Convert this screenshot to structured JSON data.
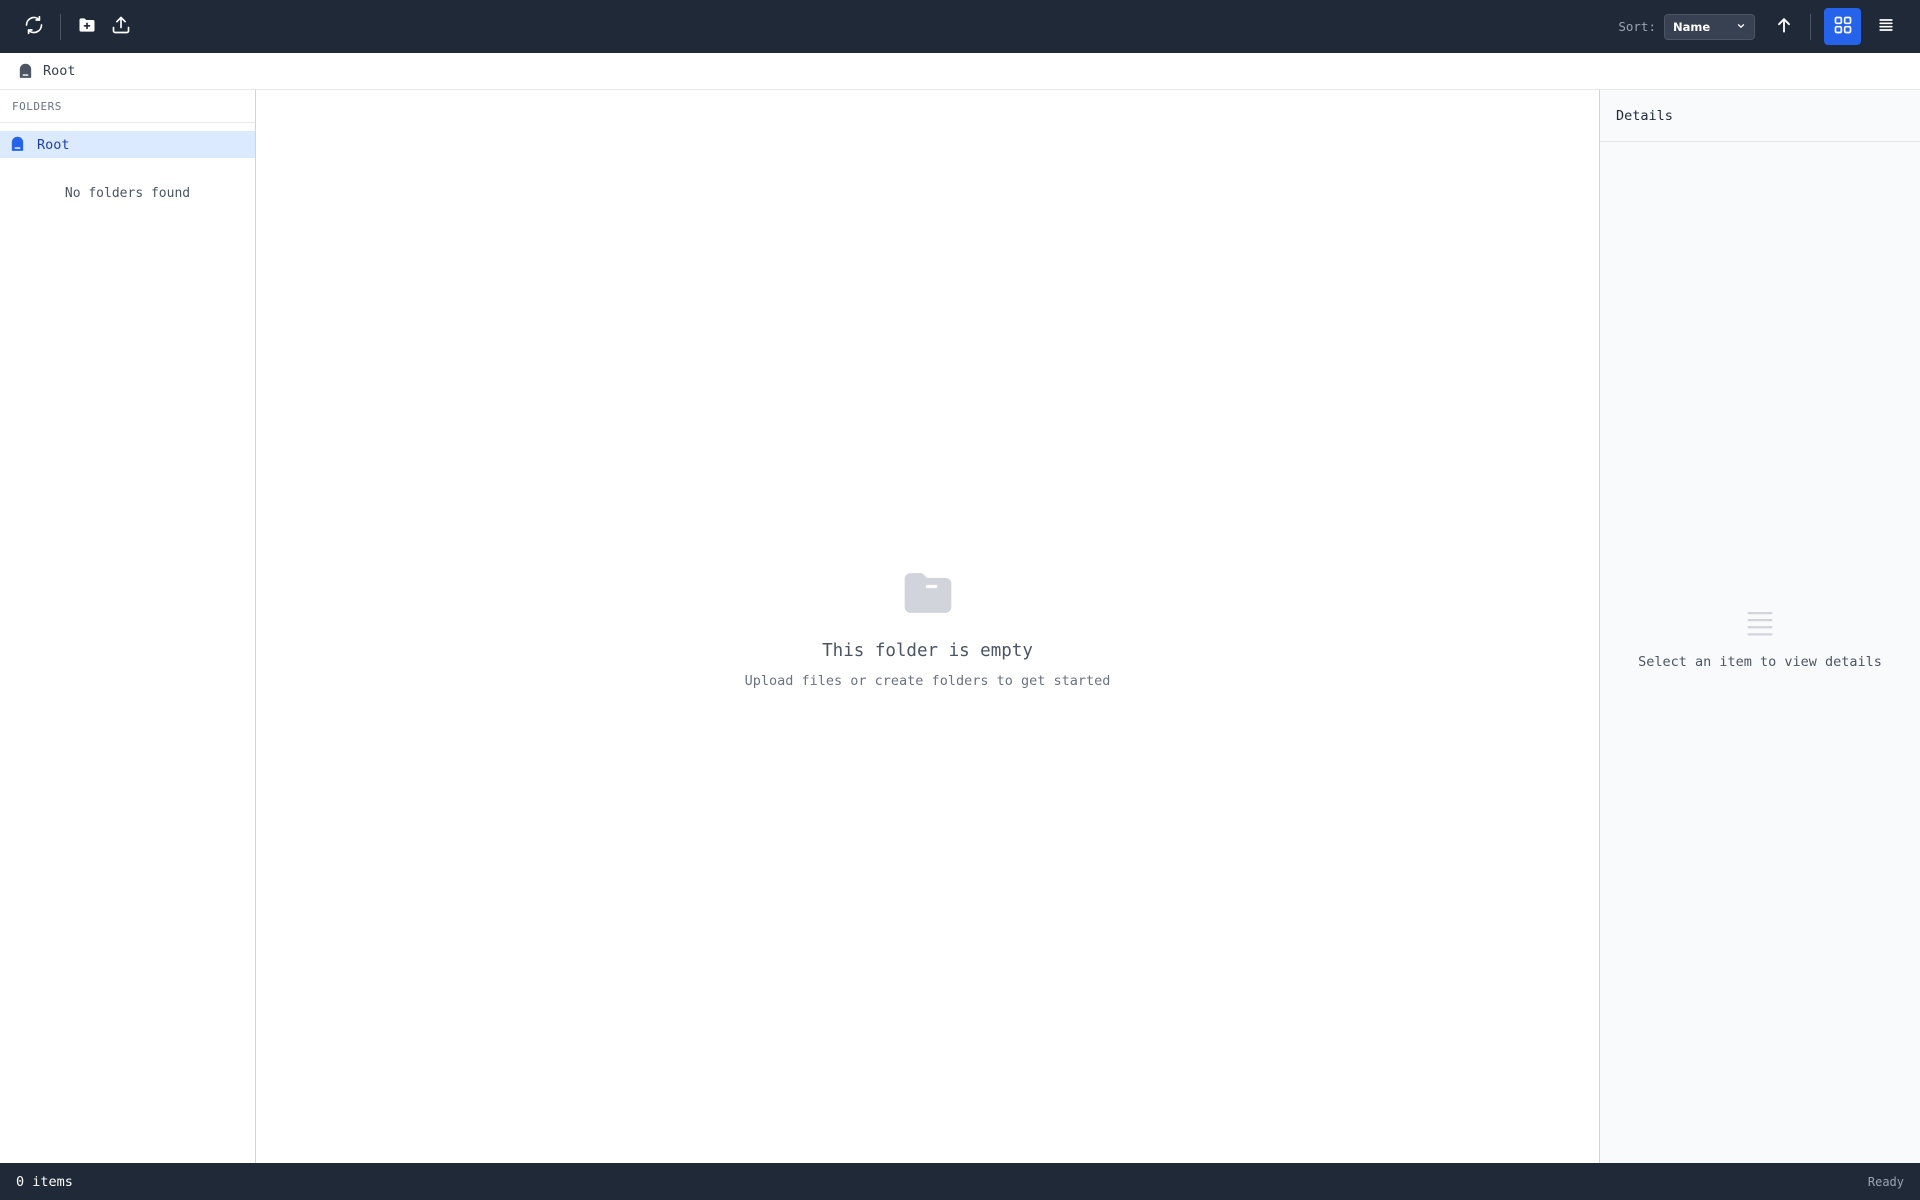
{
  "toolbar": {
    "refresh_icon": "refresh-icon",
    "new_folder_icon": "new-folder-icon",
    "upload_icon": "upload-icon",
    "sort_label": "Sort:",
    "sort_value": "Name",
    "sort_direction_icon": "arrow-up-icon",
    "grid_view_icon": "grid-view-icon",
    "list_view_icon": "list-view-icon",
    "active_view": "grid"
  },
  "breadcrumb": {
    "items": [
      {
        "label": "Root",
        "icon": "root-drive-icon"
      }
    ]
  },
  "sidebar": {
    "header": "FOLDERS",
    "tree": [
      {
        "label": "Root",
        "icon": "root-drive-icon",
        "selected": true
      }
    ],
    "empty_text": "No folders found"
  },
  "content": {
    "empty_icon": "empty-folder-icon",
    "empty_title": "This folder is empty",
    "empty_subtitle": "Upload files or create folders to get started"
  },
  "details": {
    "title": "Details",
    "placeholder_icon": "lines-icon",
    "placeholder_text": "Select an item to view details"
  },
  "statusbar": {
    "item_count": "0 items",
    "status": "Ready"
  },
  "colors": {
    "toolbar_bg": "#1f2937",
    "accent": "#2563eb",
    "selected_bg": "#dbeafe"
  }
}
